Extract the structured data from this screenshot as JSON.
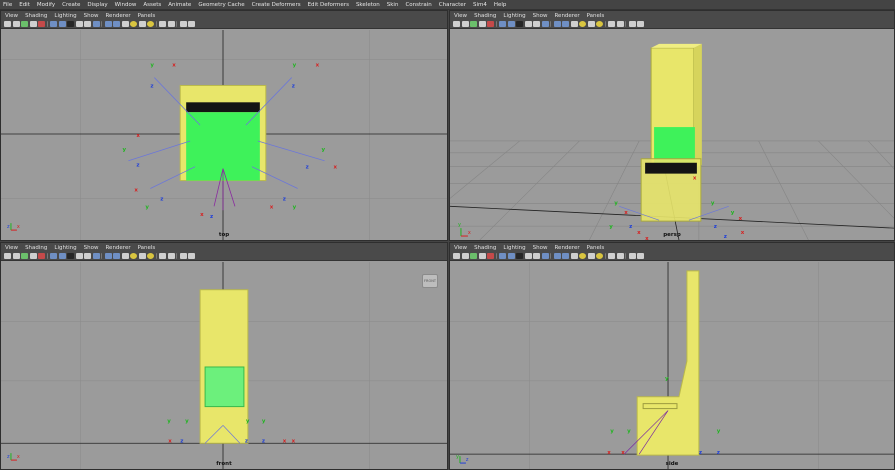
{
  "menubar": [
    "File",
    "Edit",
    "Modify",
    "Create",
    "Display",
    "Window",
    "Assets",
    "Animate",
    "Geometry Cache",
    "Create Deformers",
    "Edit Deformers",
    "Skeleton",
    "Skin",
    "Constrain",
    "Character",
    "Sim4",
    "Help"
  ],
  "panel_menu": [
    "View",
    "Shading",
    "Lighting",
    "Show",
    "Renderer",
    "Panels"
  ],
  "panels": {
    "top": {
      "camera": "top"
    },
    "persp": {
      "camera": "persp"
    },
    "front": {
      "camera": "front",
      "view_cube": "FRONT"
    },
    "side": {
      "camera": "side"
    }
  },
  "axis": {
    "x": "x",
    "y": "y",
    "z": "z"
  },
  "colors": {
    "viewport_bg": "#9b9b9b",
    "chair": "#e8e66a",
    "seat": "#3ef25a",
    "grid": "#8a8a8a",
    "axis_x": "#d62020",
    "axis_y": "#1fb51f",
    "axis_z": "#2040d8"
  }
}
